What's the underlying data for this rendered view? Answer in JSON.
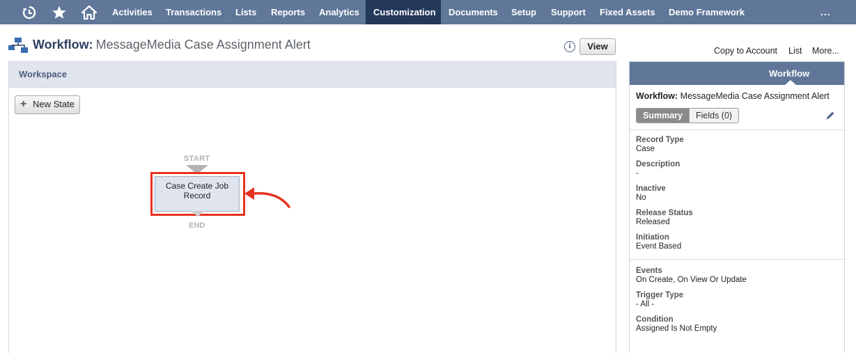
{
  "nav": {
    "icons": [
      "recent-icon",
      "star-icon",
      "home-icon"
    ],
    "items": [
      "Activities",
      "Transactions",
      "Lists",
      "Reports",
      "Analytics",
      "Customization",
      "Documents",
      "Setup",
      "Support",
      "Fixed Assets",
      "Demo Framework"
    ],
    "active": "Customization",
    "more": "..."
  },
  "header": {
    "title_label": "Workflow:",
    "title_name": "MessageMedia Case Assignment Alert",
    "view_button": "View",
    "links": [
      "Copy to Account",
      "List",
      "More..."
    ]
  },
  "workspace": {
    "title": "Workspace",
    "new_state_button": "New State",
    "start_label": "START",
    "end_label": "END",
    "state_name": "Case Create Job Record",
    "highlight_color": "#e8321f"
  },
  "panel": {
    "tab": "Workflow",
    "title_label": "Workflow:",
    "title_name": "MessageMedia Case Assignment Alert",
    "segments": [
      "Summary",
      "Fields (0)"
    ],
    "fields": [
      {
        "label": "Record Type",
        "value": "Case"
      },
      {
        "label": "Description",
        "value": "-"
      },
      {
        "label": "Inactive",
        "value": "No"
      },
      {
        "label": "Release Status",
        "value": "Released"
      },
      {
        "label": "Initiation",
        "value": "Event Based"
      }
    ],
    "trigger_fields": [
      {
        "label": "Events",
        "value": "On Create, On View Or Update"
      },
      {
        "label": "Trigger Type",
        "value": "- All -"
      },
      {
        "label": "Condition",
        "value": "Assigned Is Not Empty"
      }
    ]
  },
  "colors": {
    "nav_bg": "#607799",
    "nav_active": "#24385b",
    "workspace_header": "#dfe4ed"
  }
}
